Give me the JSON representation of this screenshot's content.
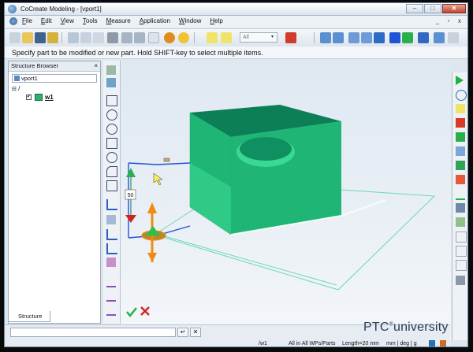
{
  "window": {
    "title": "CoCreate Modeling - [vport1]",
    "controls": [
      "–",
      "□",
      "✕"
    ]
  },
  "menu": {
    "items": [
      "File",
      "Edit",
      "View",
      "Tools",
      "Measure",
      "Application",
      "Window",
      "Help"
    ],
    "mdi_controls": [
      "_",
      "▫",
      "x"
    ]
  },
  "toolbar": {
    "filter_value": "All",
    "filter_arrow": "▾"
  },
  "hint": "Specify part to be modified or new part. Hold SHIFT-key to select multiple items.",
  "browser": {
    "title": "Structure Browser",
    "close": "×",
    "viewport": "vport1",
    "root": "/",
    "part": "w1",
    "check": "✔",
    "tab": "Structure"
  },
  "viewport": {
    "dimension": "50",
    "accept": "✔",
    "cancel": "✖"
  },
  "status": {
    "cmd_enter": "↵",
    "cmd_clear": "✕",
    "path": "/w1",
    "scope": "All in All WPs/Parts",
    "length": "Length=20 mm",
    "units": "mm | deg | g"
  },
  "brand": {
    "name": "PTC",
    "mark": "®",
    "suffix": "university"
  },
  "colors": {
    "part_top": "#0b7f55",
    "part_front": "#39d893",
    "part_right": "#1fb574",
    "selection": "#1f54d8",
    "handle": "#f08a12",
    "accent": "#2a6fb5"
  }
}
